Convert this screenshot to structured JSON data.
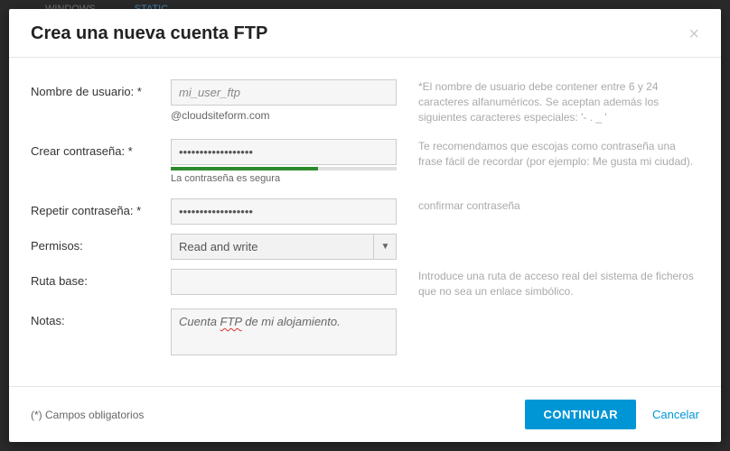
{
  "bg": {
    "tab1": "WINDOWS",
    "tab2": "STATIC"
  },
  "modal": {
    "title": "Crea una nueva cuenta FTP",
    "fields": {
      "username": {
        "label": "Nombre de usuario: *",
        "value": "mi_user_ftp",
        "suffix": "@cloudsiteform.com",
        "hint": "*El nombre de usuario debe contener entre 6 y 24 caracteres alfanuméricos. Se aceptan además los siguientes caracteres especiales: '- . _ '"
      },
      "password": {
        "label": "Crear contraseña: *",
        "value": "••••••••••••••••••",
        "strength_text": "La contraseña es segura",
        "hint": "Te recomendamos que escojas como contraseña una frase fácil de recordar (por ejemplo: Me gusta mi ciudad)."
      },
      "repeat": {
        "label": "Repetir contraseña: *",
        "value": "••••••••••••••••••",
        "hint": "confirmar contraseña"
      },
      "permissions": {
        "label": "Permisos:",
        "value": "Read and write"
      },
      "base_path": {
        "label": "Ruta base:",
        "value": "",
        "hint": "Introduce una ruta de acceso real del sistema de ficheros que no sea un enlace simbólico."
      },
      "notes": {
        "label": "Notas:",
        "value_pre": "Cuenta ",
        "value_wavy": "FTP",
        "value_post": " de mi alojamiento."
      }
    },
    "footer": {
      "required_note": "(*) Campos obligatorios",
      "continue": "CONTINUAR",
      "cancel": "Cancelar"
    }
  }
}
